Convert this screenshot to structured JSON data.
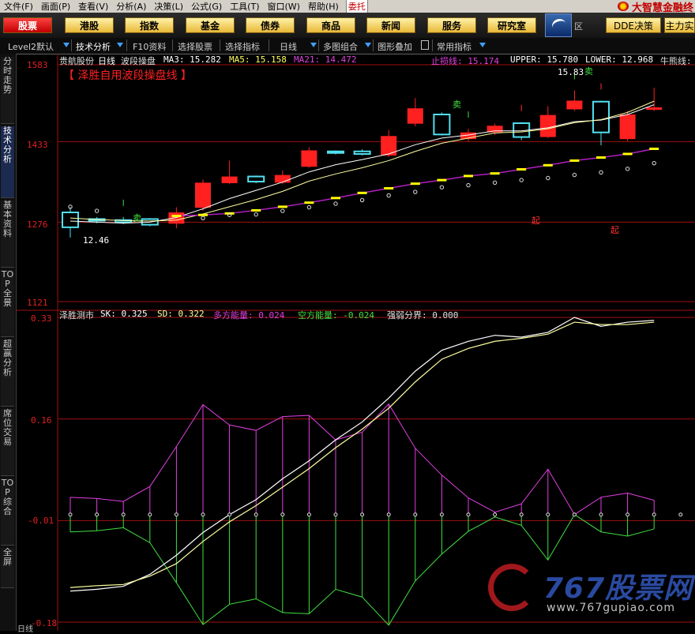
{
  "menu": [
    "文件(F)",
    "画面(P)",
    "查看(V)",
    "分析(A)",
    "决策(L)",
    "公式(G)",
    "工具(T)",
    "窗口(W)",
    "帮助(H)"
  ],
  "entrust_label": "委托",
  "brand": "大智慧金融终",
  "nav": {
    "buttons": [
      "股票",
      "港股",
      "指数",
      "基金",
      "债券",
      "商品",
      "新闻",
      "服务",
      "研究室"
    ],
    "active": "股票",
    "region_label": "区",
    "dde_label": "DDE决策",
    "main_label": "主力实"
  },
  "toolbar": [
    "Level2默认",
    "技术分析",
    "F10资料",
    "选择股票",
    "选择指标",
    "日线",
    "多图组合",
    "图形叠加",
    "常用指标"
  ],
  "sidebar_tabs": [
    "分时走势",
    "技术分析",
    "基本资料",
    "TOP全景",
    "超赢分析",
    "席位交易",
    "TOP综合",
    "全屏"
  ],
  "sidebar_active": "技术分析",
  "main_panel": {
    "stock_name": "贵航股份",
    "period": "日线",
    "indicator": "波段操盘",
    "ma3": "MA3: 15.282",
    "ma5": "MA5: 15.158",
    "ma21": "MA21: 14.472",
    "stop_loss": "止损线: 15.174",
    "upper": "UPPER: 15.780",
    "lower": "LOWER: 12.968",
    "bull": "牛熊线:",
    "banner": "【 泽胜自用波段操盘线 】",
    "y_ticks": [
      "1583",
      "1433",
      "1276",
      "1121"
    ],
    "low_label": "12.46",
    "high_label": "15.83",
    "sell_label": "卖",
    "start_label": "起"
  },
  "sub_panel": {
    "title": "泽胜测市",
    "sk": "SK: 0.325",
    "sd": "SD: 0.322",
    "bull_energy": "多方能量: 0.024",
    "bear_energy": "空方能量: -0.024",
    "boundary": "强弱分界: 0.000",
    "y_ticks": [
      "0.33",
      "0.16",
      "-0.01",
      "-0.18"
    ]
  },
  "bottom_label": "日线",
  "watermark": {
    "main": "767股票网",
    "url": "www.767gupiao.com"
  },
  "colors": {
    "up": "#ff2020",
    "down": "#50e0f0",
    "sk": "#ffffff",
    "sd": "#ffffa0",
    "bull": "#e040e0",
    "bear": "#40e040",
    "stop": "#ffff00",
    "grid": "#a01010"
  },
  "chart_data": [
    {
      "type": "candlestick",
      "title": "贵航股份 日线 波段操盘",
      "y_ticks": [
        15.83,
        14.33,
        12.76,
        11.21
      ],
      "ylim": [
        11.21,
        15.83
      ],
      "candles": [
        {
          "open": 12.95,
          "close": 12.66,
          "high": 13.05,
          "low": 12.46
        },
        {
          "open": 12.82,
          "close": 12.79,
          "high": 12.86,
          "low": 12.74
        },
        {
          "open": 12.8,
          "close": 12.76,
          "high": 12.86,
          "low": 12.72
        },
        {
          "open": 12.82,
          "close": 12.71,
          "high": 12.84,
          "low": 12.68
        },
        {
          "open": 12.73,
          "close": 12.95,
          "high": 13.05,
          "low": 12.64
        },
        {
          "open": 13.04,
          "close": 13.53,
          "high": 13.59,
          "low": 12.98
        },
        {
          "open": 13.52,
          "close": 13.65,
          "high": 13.96,
          "low": 13.5
        },
        {
          "open": 13.65,
          "close": 13.55,
          "high": 13.67,
          "low": 13.52
        },
        {
          "open": 13.53,
          "close": 13.68,
          "high": 13.77,
          "low": 13.5
        },
        {
          "open": 13.84,
          "close": 14.16,
          "high": 14.22,
          "low": 13.82
        },
        {
          "open": 14.14,
          "close": 14.11,
          "high": 14.16,
          "low": 14.08
        },
        {
          "open": 14.14,
          "close": 14.09,
          "high": 14.18,
          "low": 14.06
        },
        {
          "open": 14.06,
          "close": 14.44,
          "high": 14.56,
          "low": 14.03
        },
        {
          "open": 14.68,
          "close": 14.98,
          "high": 15.18,
          "low": 14.63
        },
        {
          "open": 14.86,
          "close": 14.47,
          "high": 14.9,
          "low": 14.45
        },
        {
          "open": 14.38,
          "close": 14.51,
          "high": 14.58,
          "low": 14.34
        },
        {
          "open": 14.51,
          "close": 14.64,
          "high": 14.68,
          "low": 14.46
        },
        {
          "open": 14.69,
          "close": 14.42,
          "high": 14.71,
          "low": 14.36
        },
        {
          "open": 14.42,
          "close": 14.85,
          "high": 15.02,
          "low": 14.4
        },
        {
          "open": 14.96,
          "close": 15.13,
          "high": 15.33,
          "low": 14.93
        },
        {
          "open": 15.11,
          "close": 14.51,
          "high": 15.13,
          "low": 14.26
        },
        {
          "open": 14.38,
          "close": 14.86,
          "high": 14.93,
          "low": 14.34
        },
        {
          "open": 14.95,
          "close": 15.0,
          "high": 15.38,
          "low": 14.93
        }
      ],
      "ma_line": [
        12.78,
        12.76,
        12.74,
        12.76,
        12.85,
        13.02,
        13.22,
        13.38,
        13.54,
        13.74,
        13.88,
        13.98,
        14.09,
        14.27,
        14.4,
        14.46,
        14.54,
        14.54,
        14.6,
        14.72,
        14.75,
        14.86,
        15.05
      ],
      "ma_line2": [
        12.84,
        12.81,
        12.79,
        12.78,
        12.8,
        12.92,
        13.06,
        13.2,
        13.36,
        13.56,
        13.7,
        13.82,
        13.96,
        14.14,
        14.3,
        14.4,
        14.5,
        14.52,
        14.58,
        14.7,
        14.76,
        14.9,
        15.12
      ],
      "stop_line": [
        null,
        null,
        null,
        null,
        12.88,
        12.9,
        12.93,
        12.99,
        13.06,
        13.14,
        13.23,
        13.33,
        13.42,
        13.51,
        13.58,
        13.66,
        13.71,
        13.79,
        13.87,
        13.96,
        14.02,
        14.09,
        14.19
      ],
      "dots": [
        13.06,
        12.98,
        null,
        null,
        null,
        12.84,
        12.9,
        12.91,
        12.98,
        13.05,
        13.12,
        13.19,
        13.28,
        13.35,
        13.44,
        13.48,
        13.53,
        13.58,
        13.62,
        13.68,
        13.73,
        13.8,
        13.91
      ],
      "annotations": [
        {
          "index": 2,
          "label": "卖"
        },
        {
          "index": 15,
          "label": "卖"
        },
        {
          "index": 19,
          "label": "卖"
        },
        {
          "index": 17,
          "label": "起"
        },
        {
          "index": 20,
          "label": "起"
        }
      ]
    },
    {
      "type": "line",
      "title": "泽胜测市",
      "y_ticks": [
        0.33,
        0.16,
        -0.01,
        -0.18
      ],
      "ylim": [
        -0.18,
        0.33
      ],
      "series": [
        {
          "name": "SK",
          "values": [
            -0.128,
            -0.125,
            -0.12,
            -0.1,
            -0.068,
            -0.03,
            0.0,
            0.025,
            0.06,
            0.09,
            0.125,
            0.155,
            0.195,
            0.24,
            0.275,
            0.29,
            0.3,
            0.297,
            0.305,
            0.33,
            0.315,
            0.322,
            0.325
          ]
        },
        {
          "name": "SD",
          "values": [
            -0.122,
            -0.119,
            -0.117,
            -0.103,
            -0.082,
            -0.045,
            -0.012,
            0.015,
            0.046,
            0.077,
            0.112,
            0.143,
            0.178,
            0.222,
            0.26,
            0.278,
            0.29,
            0.295,
            0.302,
            0.322,
            0.318,
            0.318,
            0.322
          ]
        },
        {
          "name": "多方能量",
          "values": [
            0.029,
            0.027,
            0.022,
            0.047,
            0.114,
            0.184,
            0.15,
            0.141,
            0.164,
            0.166,
            0.125,
            0.138,
            0.185,
            0.111,
            0.066,
            0.028,
            0.004,
            0.018,
            0.076,
            0.0,
            0.029,
            0.036,
            0.024
          ]
        },
        {
          "name": "空方能量",
          "values": [
            -0.029,
            -0.027,
            -0.022,
            -0.047,
            -0.114,
            -0.184,
            -0.15,
            -0.141,
            -0.164,
            -0.166,
            -0.125,
            -0.138,
            -0.185,
            -0.111,
            -0.066,
            -0.028,
            -0.004,
            -0.018,
            -0.076,
            0.0,
            -0.029,
            -0.036,
            -0.024
          ]
        }
      ],
      "boundary": 0.0
    }
  ]
}
